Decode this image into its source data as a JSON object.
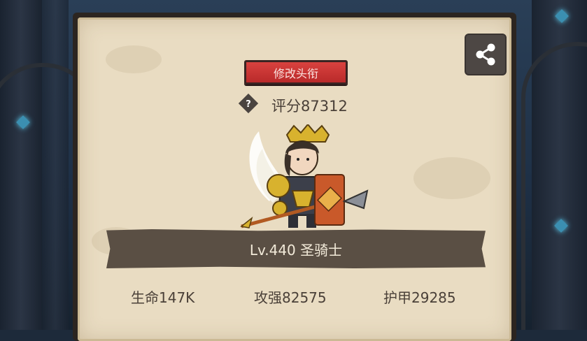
{
  "character": {
    "change_title_label": "修改头衔",
    "score_label": "评分87312",
    "level_name": "Lv.440 圣骑士"
  },
  "stats": [
    {
      "label": "生命147K"
    },
    {
      "label": "攻强82575"
    },
    {
      "label": "护甲29285"
    }
  ],
  "icons": {
    "share": "share-icon",
    "help": "question-icon"
  },
  "colors": {
    "panel_bg": "#e9dcc2",
    "button_red": "#c93634",
    "banner": "#5a4f44",
    "text": "#4a4038"
  }
}
